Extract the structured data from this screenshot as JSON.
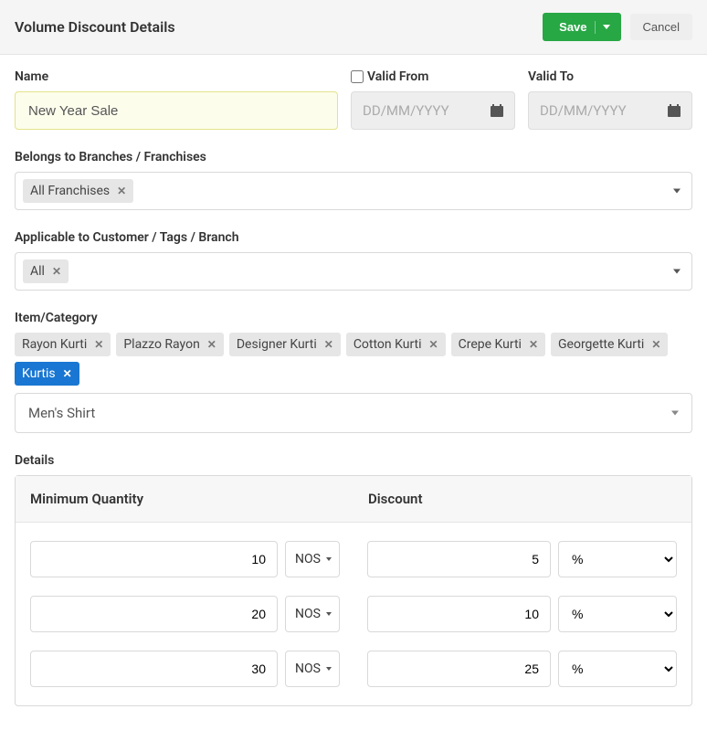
{
  "header": {
    "title": "Volume Discount Details",
    "save": "Save",
    "cancel": "Cancel"
  },
  "form": {
    "name_label": "Name",
    "name_value": "New Year Sale",
    "valid_from_label": "Valid From",
    "valid_from_placeholder": "DD/MM/YYYY",
    "valid_to_label": "Valid To",
    "valid_to_placeholder": "DD/MM/YYYY"
  },
  "branches": {
    "label": "Belongs to Branches / Franchises",
    "tags": [
      {
        "label": "All Franchises",
        "active": false
      }
    ]
  },
  "customers": {
    "label": "Applicable to Customer / Tags / Branch",
    "tags": [
      {
        "label": "All",
        "active": false
      }
    ]
  },
  "items": {
    "label": "Item/Category",
    "tags": [
      {
        "label": "Rayon Kurti",
        "active": false
      },
      {
        "label": "Plazzo Rayon",
        "active": false
      },
      {
        "label": "Designer Kurti",
        "active": false
      },
      {
        "label": "Cotton Kurti",
        "active": false
      },
      {
        "label": "Crepe Kurti",
        "active": false
      },
      {
        "label": "Georgette Kurti",
        "active": false
      },
      {
        "label": "Kurtis",
        "active": true
      }
    ],
    "select_value": "Men's Shirt"
  },
  "details": {
    "label": "Details",
    "col_qty": "Minimum Quantity",
    "col_disc": "Discount",
    "unit_label": "NOS",
    "disc_unit": "%",
    "rows": [
      {
        "qty": "10",
        "disc": "5"
      },
      {
        "qty": "20",
        "disc": "10"
      },
      {
        "qty": "30",
        "disc": "25"
      }
    ]
  }
}
